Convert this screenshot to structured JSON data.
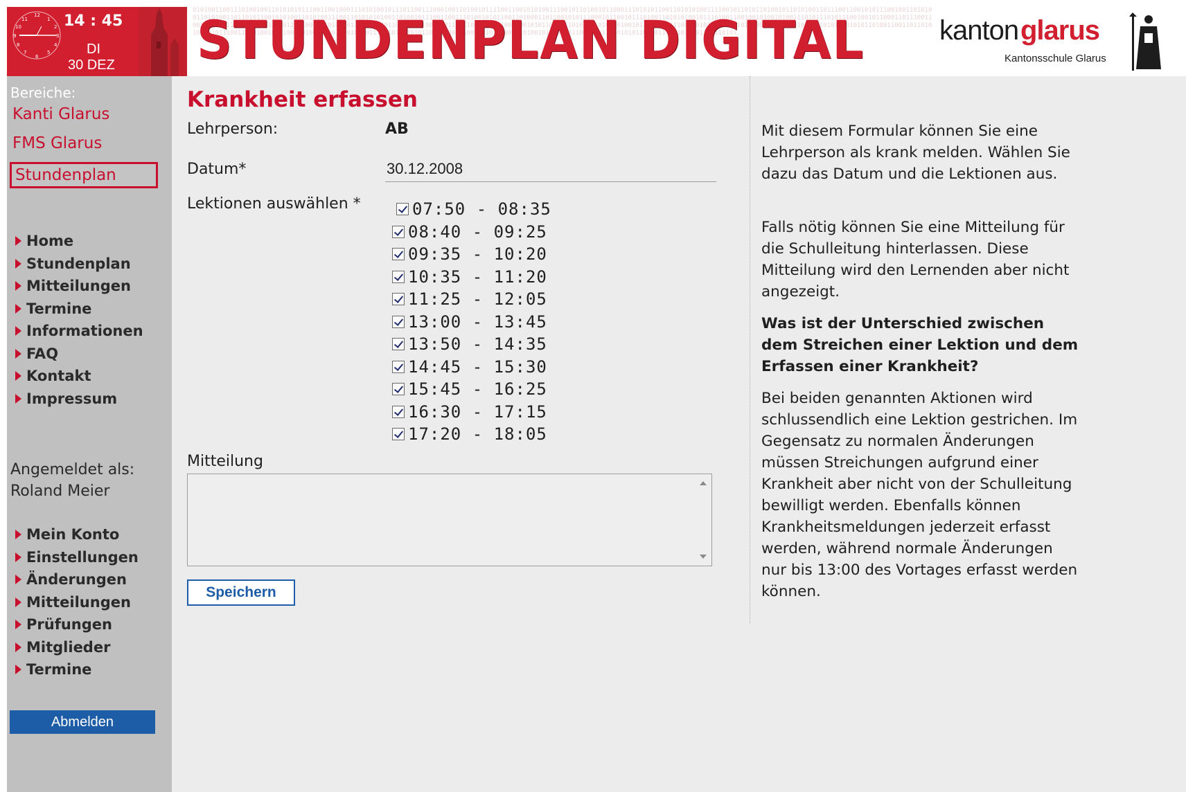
{
  "clock": {
    "time": "14 : 45",
    "day": "DI",
    "date": "30 DEZ"
  },
  "banner": {
    "title": "STUNDENPLAN DIGITAL",
    "binary": "0101001100111010010011010101011100110010001110101001011101100111000100110100101111001100101010011100101101001011000111010101100110101010011110010110101101001011010100110111001100101011100100110101001101010011011010110010101001101010011100110101010100110100101110011001110100101011001101000110110010101110001011001011101001101010100101110100110010010100101001110101110101110010010110001101110011001011000111101010101100011011001101010110110011100011001101010010101101110100101010011001010110101110101011010110100101100101011100110101001101010111001101011001011001010111010101101001100110110101010010111001110010010111001101001011010101001011100101011010110110100101001101011100101010010111010011001010111001010110100110101011001101110101"
  },
  "brand": {
    "name_a": "kanton",
    "name_b": "glarus",
    "school": "Kantonsschule Glarus"
  },
  "sidebar": {
    "areas_label": "Bereiche:",
    "areas": [
      "Kanti Glarus",
      "FMS Glarus",
      "Stundenplan"
    ],
    "nav_main": [
      "Home",
      "Stundenplan",
      "Mitteilungen",
      "Termine",
      "Informationen",
      "FAQ",
      "Kontakt",
      "Impressum"
    ],
    "login_label": "Angemeldet als:",
    "login_user": "Roland Meier",
    "nav_account": [
      "Mein Konto",
      "Einstellungen",
      "Änderungen",
      "Mitteilungen",
      "Prüfungen",
      "Mitglieder",
      "Termine"
    ],
    "logout": "Abmelden"
  },
  "form": {
    "title": "Krankheit erfassen",
    "teacher_label": "Lehrperson:",
    "teacher_value": "AB",
    "date_label": "Datum*",
    "date_value": "30.12.2008",
    "lessons_label": "Lektionen auswählen *",
    "lessons": [
      "07:50 - 08:35",
      "08:40 - 09:25",
      "09:35 - 10:20",
      "10:35 - 11:20",
      "11:25 - 12:05",
      "13:00 - 13:45",
      "13:50 - 14:35",
      "14:45 - 15:30",
      "15:45 - 16:25",
      "16:30 - 17:15",
      "17:20 - 18:05"
    ],
    "message_label": "Mitteilung",
    "message_value": "",
    "save_label": "Speichern"
  },
  "help": {
    "p1": "Mit diesem Formular können Sie eine Lehrperson als krank melden. Wählen Sie dazu das Datum und die Lektionen aus.",
    "p2": "Falls nötig können Sie eine Mitteilung für die Schulleitung hinterlassen. Diese Mitteilung wird den Lernenden aber nicht angezeigt.",
    "question": "Was ist der Unterschied zwischen dem Streichen einer Lektion und dem Erfassen einer Krankheit?",
    "p3": "Bei beiden genannten Aktionen wird schlussendlich eine Lektion gestrichen. Im Gegensatz zu normalen Änderungen müssen Streichungen aufgrund einer Krankheit aber nicht von der Schulleitung bewilligt werden. Ebenfalls können Krankheitsmeldungen jederzeit erfasst werden, während normale Änderungen nur bis 13:00 des Vortages erfasst werden können."
  },
  "colors": {
    "brand_red": "#c8102e",
    "header_red": "#d11f2f",
    "sidebar_gray": "#c0c0c0",
    "content_bg": "#ececec",
    "button_blue": "#1d5da7"
  },
  "icons": [
    "analog-clock-icon",
    "church-tower-icon",
    "saint-fridolin-icon",
    "triangle-bullet-icon",
    "checkbox-checked-icon"
  ]
}
